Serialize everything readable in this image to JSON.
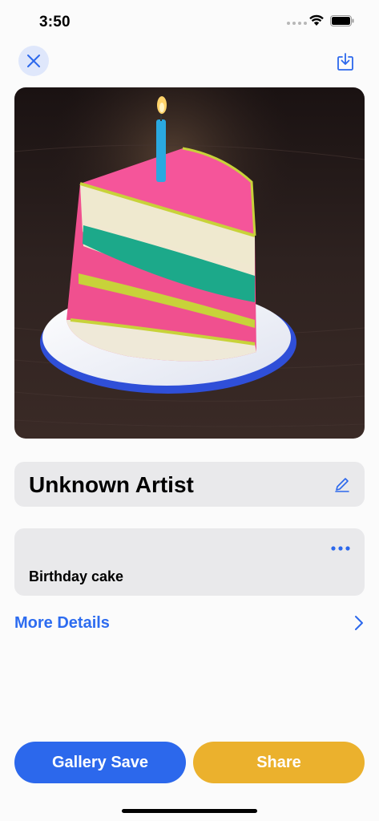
{
  "status_bar": {
    "time": "3:50"
  },
  "nav": {
    "close_icon": "close-icon",
    "download_icon": "download-icon"
  },
  "image": {
    "subject": "birthday-cake-slice"
  },
  "artist": {
    "name": "Unknown Artist",
    "edit_icon": "pencil-icon"
  },
  "prompt": {
    "text": "Birthday cake",
    "more_icon": "ellipsis-icon"
  },
  "details": {
    "label": "More Details",
    "chevron_icon": "chevron-right-icon"
  },
  "actions": {
    "gallery_save": "Gallery Save",
    "share": "Share"
  },
  "colors": {
    "accent_blue": "#2c68ec",
    "accent_yellow": "#ebb12d",
    "card_bg": "#e9e9eb"
  }
}
